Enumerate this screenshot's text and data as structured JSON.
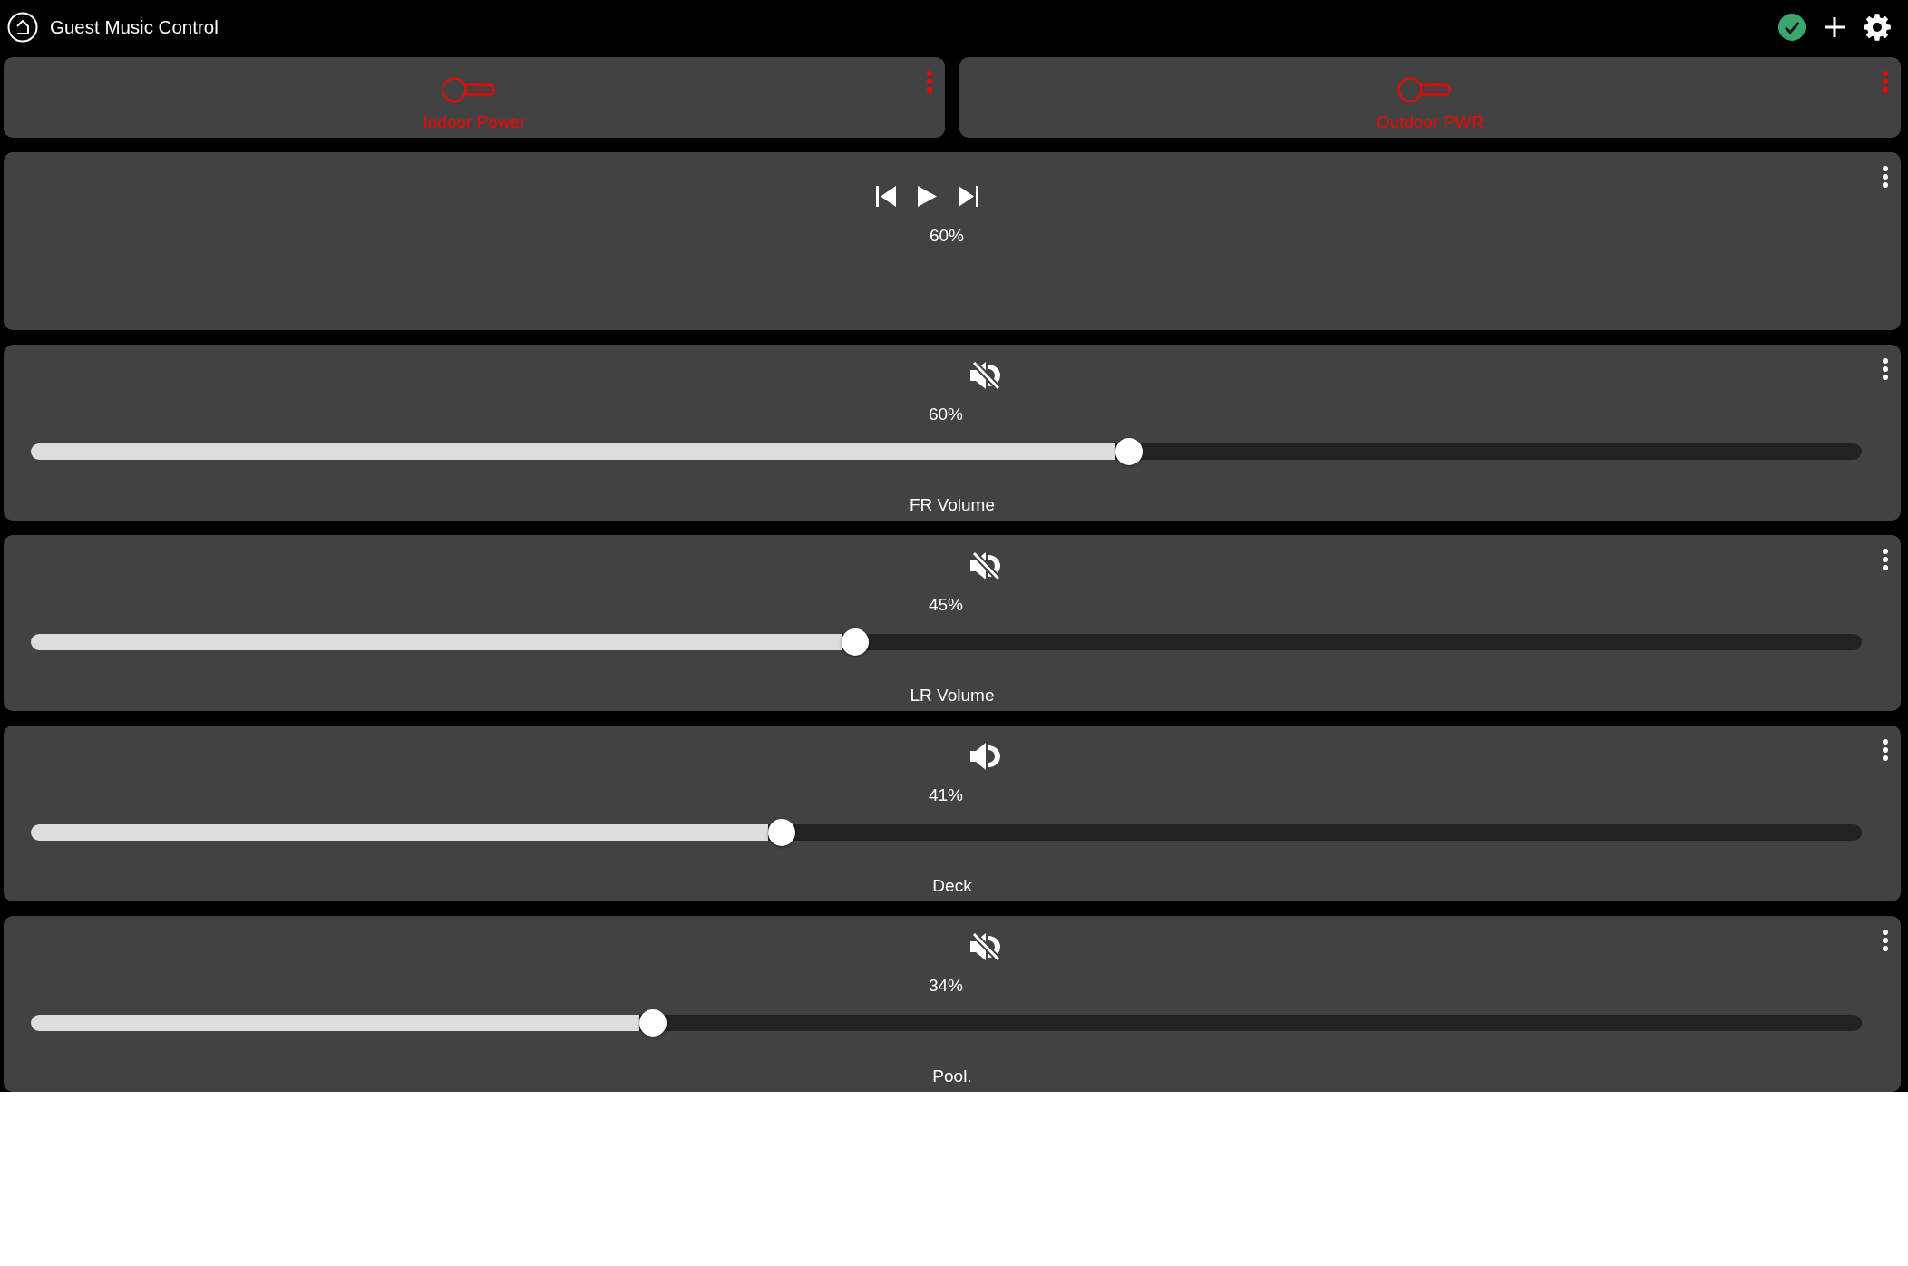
{
  "header": {
    "title": "Guest Music Control"
  },
  "switches": [
    {
      "label": "Indoor Power",
      "on": false
    },
    {
      "label": "Outdoor PWR",
      "on": false
    }
  ],
  "player": {
    "playing": false,
    "reading": "60%"
  },
  "volumes": [
    {
      "label": "FR Volume",
      "muted": true,
      "reading": "60%",
      "level": 0.6
    },
    {
      "label": "LR Volume",
      "muted": true,
      "reading": "45%",
      "level": 0.45
    },
    {
      "label": "Deck",
      "muted": false,
      "reading": "41%",
      "level": 0.41
    },
    {
      "label": "Pool.",
      "muted": true,
      "reading": "34%",
      "level": 0.34
    }
  ]
}
